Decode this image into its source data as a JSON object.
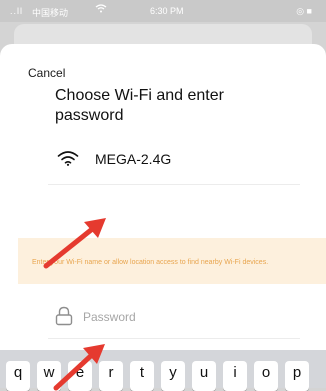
{
  "status_bar": {
    "signal": "..ll",
    "carrier": "中国移动",
    "time": "6:30 PM",
    "right": "◎ ■"
  },
  "header": {
    "cancel_label": "Cancel"
  },
  "main": {
    "title": "Choose Wi-Fi and enter password",
    "wifi_name": "MEGA-2.4G",
    "warning": "Enter your Wi-Fi name or allow location access to find nearby Wi-Fi devices.",
    "password_placeholder": "Password"
  },
  "keyboard": {
    "keys": [
      "q",
      "w",
      "e",
      "r",
      "t",
      "y",
      "u",
      "i",
      "o",
      "p"
    ]
  },
  "colors": {
    "warning_bg": "#fdf0dd",
    "warning_text": "#e8a54f",
    "arrow": "#e53a2f"
  },
  "icons": {
    "wifi": "wifi-icon",
    "lock": "lock-icon"
  }
}
